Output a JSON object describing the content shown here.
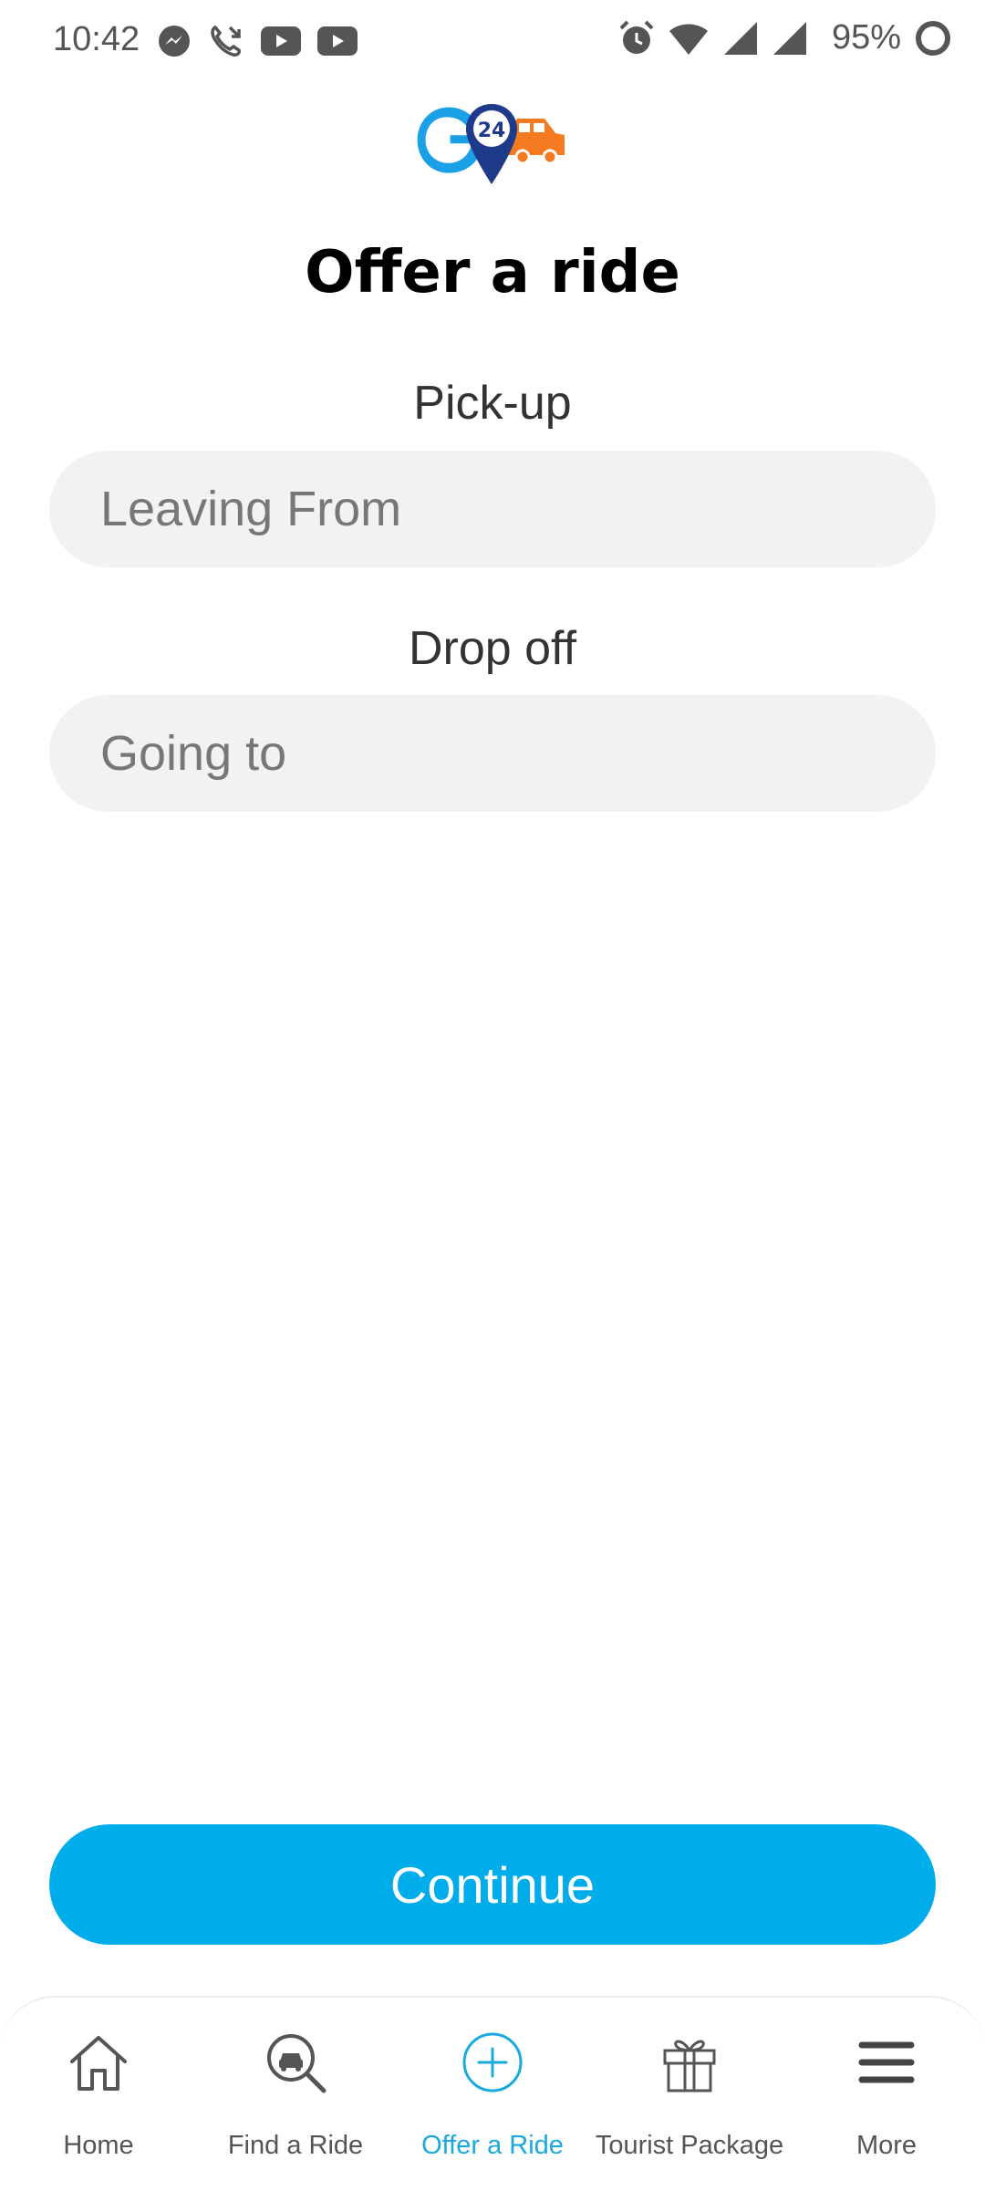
{
  "status_bar": {
    "time": "10:42",
    "battery_percent": "95%",
    "left_icons": [
      "messenger-icon",
      "missed-call-icon",
      "youtube-icon",
      "youtube-icon"
    ],
    "right_icons": [
      "alarm-icon",
      "wifi-icon",
      "signal-icon",
      "signal-icon",
      "battery-ring-icon"
    ]
  },
  "logo": {
    "icon": "go24-logo",
    "text": "24",
    "colors": {
      "blue": "#1aa0e6",
      "navy": "#1e3a8a",
      "orange": "#f47b20"
    }
  },
  "page": {
    "title": "Offer a ride"
  },
  "form": {
    "pickup_label": "Pick-up",
    "pickup_placeholder": "Leaving From",
    "pickup_value": "",
    "dropoff_label": "Drop off",
    "dropoff_placeholder": "Going to",
    "dropoff_value": ""
  },
  "actions": {
    "continue_label": "Continue"
  },
  "colors": {
    "accent": "#00adeb",
    "input_bg": "#f2f2f2",
    "active_nav": "#1aa9dc"
  },
  "bottom_nav": {
    "items": [
      {
        "label": "Home",
        "icon": "home-icon",
        "active": false
      },
      {
        "label": "Find a Ride",
        "icon": "search-car-icon",
        "active": false
      },
      {
        "label": "Offer a Ride",
        "icon": "plus-circle-icon",
        "active": true
      },
      {
        "label": "Tourist Package",
        "icon": "gift-icon",
        "active": false
      },
      {
        "label": "More",
        "icon": "menu-icon",
        "active": false
      }
    ]
  }
}
